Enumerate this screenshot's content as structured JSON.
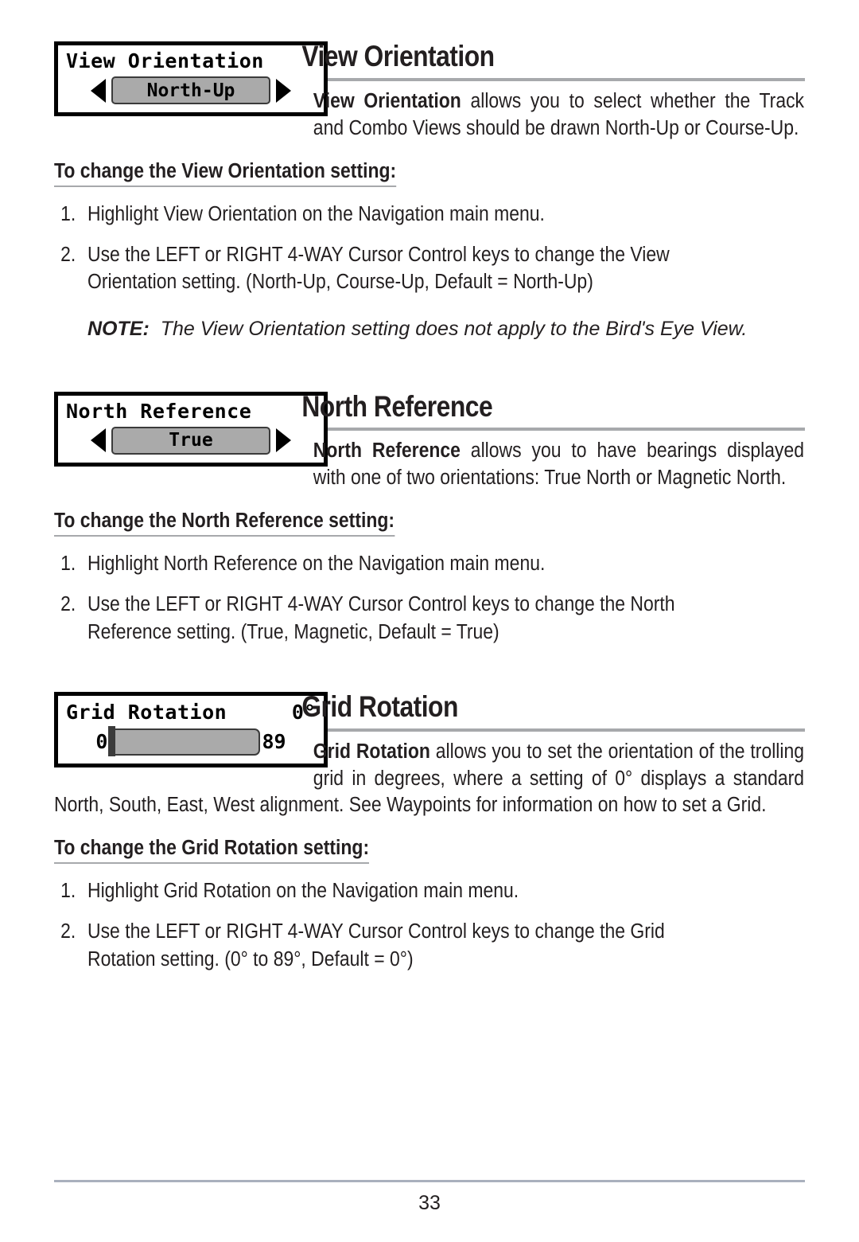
{
  "page": {
    "number": "33"
  },
  "sections": [
    {
      "id": "view-orientation",
      "widget": {
        "type": "selector",
        "title": "View Orientation",
        "value": "North-Up",
        "left_arrow": "left-arrow-icon",
        "right_arrow": "right-arrow-icon"
      },
      "heading": "View Orientation",
      "intro_bold": "View Orientation",
      "intro_rest": " allows you to select whether the Track and Combo Views should be drawn North-Up or Course-Up.",
      "subhead": "To change the View Orientation setting:",
      "steps": [
        {
          "num": "1.",
          "text": "Highlight View Orientation on the Navigation main menu."
        },
        {
          "num": "2.",
          "text": "Use the LEFT or RIGHT 4-WAY Cursor Control keys to change the View Orientation setting. (North-Up, Course-Up, Default = North-Up)"
        }
      ],
      "note_label": "NOTE:",
      "note_text": "The View Orientation setting does not apply to the Bird's Eye View."
    },
    {
      "id": "north-reference",
      "widget": {
        "type": "selector",
        "title": "North Reference",
        "value": "True",
        "left_arrow": "left-arrow-icon",
        "right_arrow": "right-arrow-icon"
      },
      "heading": "North Reference",
      "intro_bold": "North Reference",
      "intro_rest": " allows you to have bearings displayed with one of two orientations: True North or Magnetic North.",
      "subhead": "To change the North Reference setting:",
      "steps": [
        {
          "num": "1.",
          "text": "Highlight North Reference on the Navigation main menu."
        },
        {
          "num": "2.",
          "text": "Use the LEFT or RIGHT 4-WAY Cursor Control keys to change the North Reference setting. (True, Magnetic, Default = True)"
        }
      ]
    },
    {
      "id": "grid-rotation",
      "widget": {
        "type": "slider",
        "title": "Grid Rotation",
        "corner_value": "0°",
        "min": "0",
        "max": "89",
        "handle_position_percent": 0
      },
      "heading": "Grid Rotation",
      "intro_bold": "Grid Rotation",
      "intro_rest": " allows you to set the orientation of the trolling grid in degrees, where a setting of 0° displays a standard North, South, East, West alignment. See Waypoints for information on how to set a Grid.",
      "subhead": "To change the Grid Rotation setting:",
      "steps": [
        {
          "num": "1.",
          "text": "Highlight Grid Rotation on the Navigation main menu."
        },
        {
          "num": "2.",
          "text": "Use the LEFT or RIGHT 4-WAY Cursor Control keys to change the Grid Rotation setting. (0° to 89°, Default = 0°)"
        }
      ]
    }
  ],
  "colors": {
    "rule": "#a7a9ac",
    "text": "#231f20",
    "lcd_value_bg": "#aaaaaa",
    "footer_rule": "#a9b0bd"
  }
}
